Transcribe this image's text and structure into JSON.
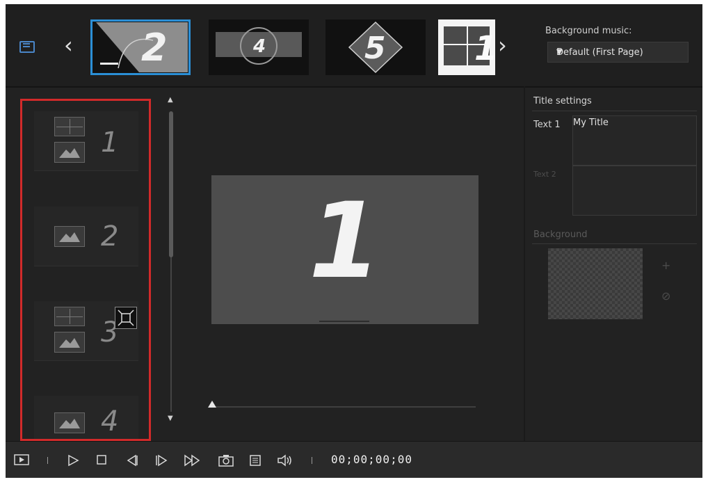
{
  "topbar": {
    "thumbnails": [
      {
        "number": "2"
      },
      {
        "number": "4"
      },
      {
        "number": "5"
      },
      {
        "number": "1"
      }
    ],
    "background_music_label": "Background music:",
    "background_music_value": "Default (First Page)"
  },
  "pages": [
    {
      "number": "1",
      "layout": "split+image"
    },
    {
      "number": "2",
      "layout": "image"
    },
    {
      "number": "3",
      "layout": "split+image"
    },
    {
      "number": "4",
      "layout": "image"
    }
  ],
  "preview": {
    "number": "1"
  },
  "title_settings": {
    "heading": "Title settings",
    "text1_label": "Text 1",
    "text1_value": "My Title",
    "text2_label": "Text 2",
    "text2_value": "",
    "background_label": "Background",
    "add_symbol": "+",
    "remove_symbol": "⊘"
  },
  "transport": {
    "timecode": "00;00;00;00"
  },
  "colors": {
    "selection_blue": "#2b8fd6",
    "highlight_red": "#d22a2a",
    "panel_bg": "#222222"
  }
}
